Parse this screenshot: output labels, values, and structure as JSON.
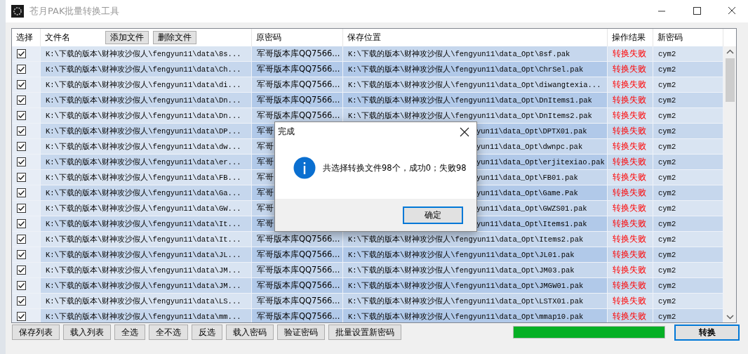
{
  "window": {
    "title": "苍月PAK批量转换工具"
  },
  "table": {
    "columns": [
      {
        "label": "选择"
      },
      {
        "label": "文件名"
      },
      {
        "label": "原密码"
      },
      {
        "label": "保存位置"
      },
      {
        "label": "操作结果"
      },
      {
        "label": "新密码"
      }
    ],
    "header_buttons": [
      "添加文件",
      "删除文件"
    ],
    "rows": [
      {
        "checked": true,
        "covered": false,
        "file": "K:\\下载的版本\\财神攻沙假人\\fengyun11\\data\\8s...",
        "password": "军哥版本库QQ7566...",
        "save": "K:\\下载的版本\\财神攻沙假人\\fengyun11\\data_Opt\\8sf.pak",
        "result": "转换失败",
        "new_password": "cym2"
      },
      {
        "checked": true,
        "covered": false,
        "file": "K:\\下载的版本\\财神攻沙假人\\fengyun11\\data\\Ch...",
        "password": "军哥版本库QQ7566...",
        "save": "K:\\下载的版本\\财神攻沙假人\\fengyun11\\data_Opt\\ChrSel.pak",
        "result": "转换失败",
        "new_password": "cym2"
      },
      {
        "checked": true,
        "covered": false,
        "file": "K:\\下载的版本\\财神攻沙假人\\fengyun11\\data\\di...",
        "password": "军哥版本库QQ7566...",
        "save": "K:\\下载的版本\\财神攻沙假人\\fengyun11\\data_Opt\\diwangtexia...",
        "result": "转换失败",
        "new_password": "cym2"
      },
      {
        "checked": true,
        "covered": false,
        "file": "K:\\下载的版本\\财神攻沙假人\\fengyun11\\data\\Dn...",
        "password": "军哥版本库QQ7566...",
        "save": "K:\\下载的版本\\财神攻沙假人\\fengyun11\\data_Opt\\DnItems1.pak",
        "result": "转换失败",
        "new_password": "cym2"
      },
      {
        "checked": true,
        "covered": false,
        "file": "K:\\下载的版本\\财神攻沙假人\\fengyun11\\data\\Dn...",
        "password": "军哥版本库QQ7566...",
        "save": "K:\\下载的版本\\财神攻沙假人\\fengyun11\\data_Opt\\DnItems2.pak",
        "result": "转换失败",
        "new_password": "cym2"
      },
      {
        "checked": true,
        "covered": true,
        "file": "K:\\下载的版本\\财神攻沙假人\\fengyun11\\data\\DP...",
        "password": "军哥",
        "save": "yun11\\data_Opt\\DPTX01.pak",
        "result": "转换失败",
        "new_password": "cym2"
      },
      {
        "checked": true,
        "covered": true,
        "file": "K:\\下载的版本\\财神攻沙假人\\fengyun11\\data\\dw...",
        "password": "军哥",
        "save": "yun11\\data_Opt\\dwnpc.pak",
        "result": "转换失败",
        "new_password": "cym2"
      },
      {
        "checked": true,
        "covered": true,
        "file": "K:\\下载的版本\\财神攻沙假人\\fengyun11\\data\\er...",
        "password": "军哥",
        "save": "yun11\\data_Opt\\erjitexiao.pak",
        "result": "转换失败",
        "new_password": "cym2"
      },
      {
        "checked": true,
        "covered": true,
        "file": "K:\\下载的版本\\财神攻沙假人\\fengyun11\\data\\FB...",
        "password": "军哥",
        "save": "yun11\\data_Opt\\FB01.pak",
        "result": "转换失败",
        "new_password": "cym2"
      },
      {
        "checked": true,
        "covered": true,
        "file": "K:\\下载的版本\\财神攻沙假人\\fengyun11\\data\\Ga...",
        "password": "军哥",
        "save": "yun11\\data_Opt\\Game.Pak",
        "result": "转换失败",
        "new_password": "cym2"
      },
      {
        "checked": true,
        "covered": true,
        "file": "K:\\下载的版本\\财神攻沙假人\\fengyun11\\data\\GW...",
        "password": "军哥",
        "save": "yun11\\data_Opt\\GWZS01.pak",
        "result": "转换失败",
        "new_password": "cym2"
      },
      {
        "checked": true,
        "covered": true,
        "file": "K:\\下载的版本\\财神攻沙假人\\fengyun11\\data\\It...",
        "password": "军哥",
        "save": "yun11\\data_Opt\\Items1.pak",
        "result": "转换失败",
        "new_password": "cym2"
      },
      {
        "checked": true,
        "covered": false,
        "file": "K:\\下载的版本\\财神攻沙假人\\fengyun11\\data\\It...",
        "password": "军哥版本库QQ7566...",
        "save": "K:\\下载的版本\\财神攻沙假人\\fengyun11\\data_Opt\\Items2.pak",
        "result": "转换失败",
        "new_password": "cym2"
      },
      {
        "checked": true,
        "covered": false,
        "file": "K:\\下载的版本\\财神攻沙假人\\fengyun11\\data\\JL...",
        "password": "军哥版本库QQ7566...",
        "save": "K:\\下载的版本\\财神攻沙假人\\fengyun11\\data_Opt\\JL01.pak",
        "result": "转换失败",
        "new_password": "cym2"
      },
      {
        "checked": true,
        "covered": false,
        "file": "K:\\下载的版本\\财神攻沙假人\\fengyun11\\data\\JM...",
        "password": "军哥版本库QQ7566...",
        "save": "K:\\下载的版本\\财神攻沙假人\\fengyun11\\data_Opt\\JM03.pak",
        "result": "转换失败",
        "new_password": "cym2"
      },
      {
        "checked": true,
        "covered": false,
        "file": "K:\\下载的版本\\财神攻沙假人\\fengyun11\\data\\JM...",
        "password": "军哥版本库QQ7566...",
        "save": "K:\\下载的版本\\财神攻沙假人\\fengyun11\\data_Opt\\JMGW01.pak",
        "result": "转换失败",
        "new_password": "cym2"
      },
      {
        "checked": true,
        "covered": false,
        "file": "K:\\下载的版本\\财神攻沙假人\\fengyun11\\data\\LS...",
        "password": "军哥版本库QQ7566...",
        "save": "K:\\下载的版本\\财神攻沙假人\\fengyun11\\data_Opt\\LSTX01.pak",
        "result": "转换失败",
        "new_password": "cym2"
      },
      {
        "checked": true,
        "covered": false,
        "file": "K:\\下载的版本\\财神攻沙假人\\fengyun11\\data\\mm...",
        "password": "军哥版本库QQ7566...",
        "save": "K:\\下载的版本\\财神攻沙假人\\fengyun11\\data_Opt\\mmap10.pak",
        "result": "转换失败",
        "new_password": "cym2"
      }
    ]
  },
  "toolbar": {
    "buttons": [
      "保存列表",
      "载入列表",
      "全选",
      "全不选",
      "反选",
      "载入密码",
      "验证密码",
      "批量设置新密码"
    ],
    "progress": {
      "level": 1.0
    },
    "convert_button": "转换"
  },
  "dialog": {
    "title": "完成",
    "message": "共选择转换文件98个，成功0；失败98",
    "ok_button": "确定"
  }
}
